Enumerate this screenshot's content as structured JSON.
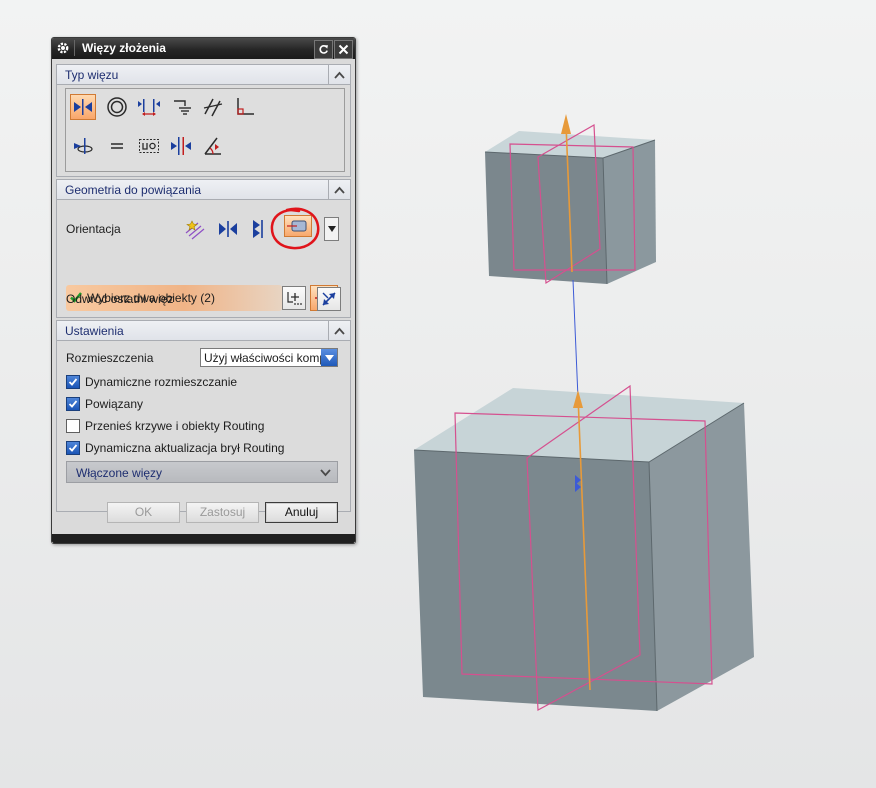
{
  "dialog": {
    "title": "Więzy złożenia",
    "sections": {
      "typ_wiezu": {
        "title": "Typ więzu"
      },
      "geometria": {
        "title": "Geometria do powiązania",
        "orientation_label": "Orientacja",
        "select_prompt": "Wybierz dwa obiekty (2)",
        "reverse_label": "Odwróć ostatni więz"
      },
      "ustawienia": {
        "title": "Ustawienia",
        "rozmieszczenia_label": "Rozmieszczenia",
        "rozmieszczenia_value": "Użyj właściwości komponentu",
        "checkboxes": [
          {
            "label": "Dynamiczne rozmieszczanie",
            "checked": true
          },
          {
            "label": "Powiązany",
            "checked": true
          },
          {
            "label": "Przenieś krzywe i obiekty Routing",
            "checked": false
          },
          {
            "label": "Dynamiczna aktualizacja brył Routing",
            "checked": true
          }
        ],
        "subsection": "Włączone więzy"
      }
    },
    "buttons": {
      "ok": "OK",
      "apply": "Zastosuj",
      "cancel": "Anuluj"
    }
  },
  "icons": {
    "title": [
      "gear-icon",
      "reset-icon",
      "close-icon"
    ],
    "constraint_types": [
      "touch-align-icon",
      "concentric-icon",
      "distance-icon",
      "fix-icon",
      "parallel-icon",
      "perpendicular-icon",
      "center-icon",
      "equal-icon",
      "fit-icon",
      "bond-icon",
      "angle-icon"
    ],
    "orientation": [
      "auto-orient-icon",
      "touch-icon",
      "align-icon",
      "infer-center-icon"
    ]
  },
  "colors": {
    "selection_accent": "#f8a86d",
    "annotation_circle": "#e0141b",
    "part_face": "#7e8b91",
    "part_top": "#c7d4d7",
    "plane_outline": "#d5508f",
    "axis_arrow": "#e79a3a",
    "axis_line": "#3d5bd6",
    "checkbox_checked": "#1b55b6"
  }
}
